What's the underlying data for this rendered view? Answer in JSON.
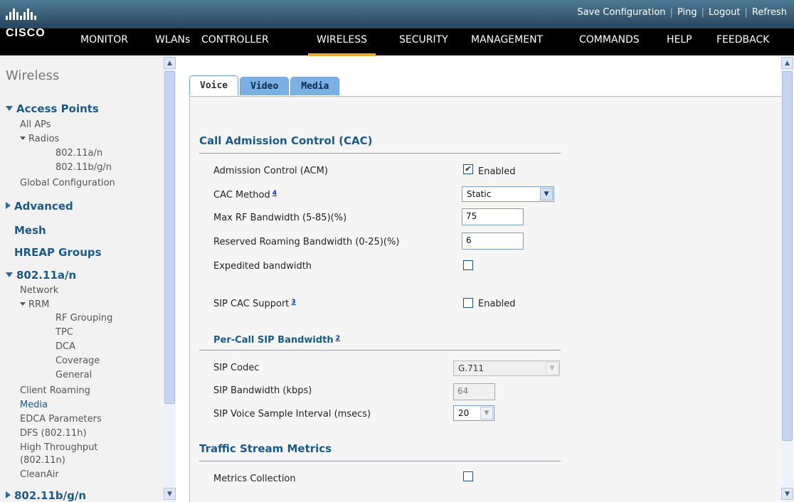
{
  "header": {
    "logo_text": "CISCO",
    "links": [
      "Save Configuration",
      "Ping",
      "Logout",
      "Refresh"
    ],
    "nav": [
      "MONITOR",
      "WLANs",
      "CONTROLLER",
      "WIRELESS",
      "SECURITY",
      "MANAGEMENT",
      "COMMANDS",
      "HELP",
      "FEEDBACK"
    ],
    "active_nav": "WIRELESS",
    "accent_color": "#f0a830"
  },
  "sidebar": {
    "title": "Wireless",
    "access_points": "Access Points",
    "all_aps": "All APs",
    "radios": "Radios",
    "radio_a": "802.11a/n",
    "radio_b": "802.11b/g/n",
    "global_config": "Global Configuration",
    "advanced": "Advanced",
    "mesh": "Mesh",
    "hreap": "HREAP Groups",
    "band_a": "802.11a/n",
    "network": "Network",
    "rrm": "RRM",
    "rf_grouping": "RF Grouping",
    "tpc": "TPC",
    "dca": "DCA",
    "coverage": "Coverage",
    "general": "General",
    "client_roaming": "Client Roaming",
    "media": "Media",
    "edca": "EDCA Parameters",
    "dfs": "DFS (802.11h)",
    "high_throughput": "High Throughput",
    "high_throughput_2": "(802.11n)",
    "cleanair": "CleanAir",
    "band_b": "802.11b/g/n"
  },
  "tabs": [
    "Voice",
    "Video",
    "Media"
  ],
  "active_tab": "Voice",
  "cac": {
    "heading": "Call Admission Control (CAC)",
    "acm_label": "Admission Control (ACM)",
    "acm_checked": true,
    "acm_text": "Enabled",
    "method_label": "CAC Method",
    "method_note": "4",
    "method_value": "Static",
    "max_bw_label": "Max RF Bandwidth (5-85)(%)",
    "max_bw_value": "75",
    "roam_label": "Reserved Roaming Bandwidth (0-25)(%)",
    "roam_value": "6",
    "expedited_label": "Expedited bandwidth",
    "expedited_checked": false,
    "sip_label": "SIP CAC Support",
    "sip_note": "3",
    "sip_checked": false,
    "sip_text": "Enabled"
  },
  "per_call": {
    "heading": "Per-Call SIP Bandwidth",
    "heading_note": "2",
    "codec_label": "SIP Codec",
    "codec_value": "G.711",
    "bw_label": "SIP Bandwidth (kbps)",
    "bw_value": "64",
    "interval_label": "SIP Voice Sample Interval (msecs)",
    "interval_value": "20"
  },
  "tsm": {
    "heading": "Traffic Stream Metrics",
    "metrics_label": "Metrics Collection",
    "metrics_checked": false
  }
}
